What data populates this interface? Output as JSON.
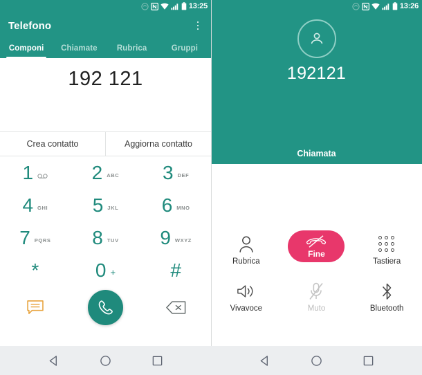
{
  "left": {
    "statusbar": {
      "time": "13:25",
      "icons": [
        "sync-icon",
        "nfc-icon",
        "wifi-icon",
        "signal-icon",
        "battery-icon"
      ]
    },
    "appbar": {
      "title": "Telefono",
      "overflow_icon": "overflow-menu-icon"
    },
    "tabs": [
      {
        "label": "Componi",
        "active": true
      },
      {
        "label": "Chiamate",
        "active": false
      },
      {
        "label": "Rubrica",
        "active": false
      },
      {
        "label": "Gruppi",
        "active": false
      }
    ],
    "dialed_number": "192 121",
    "contact_actions": [
      {
        "label": "Crea contatto"
      },
      {
        "label": "Aggiorna contatto"
      }
    ],
    "keys": [
      {
        "digit": "1",
        "sub": "",
        "icon": "voicemail-icon"
      },
      {
        "digit": "2",
        "sub": "ABC",
        "icon": ""
      },
      {
        "digit": "3",
        "sub": "DEF",
        "icon": ""
      },
      {
        "digit": "4",
        "sub": "GHI",
        "icon": ""
      },
      {
        "digit": "5",
        "sub": "JKL",
        "icon": ""
      },
      {
        "digit": "6",
        "sub": "MNO",
        "icon": ""
      },
      {
        "digit": "7",
        "sub": "PQRS",
        "icon": ""
      },
      {
        "digit": "8",
        "sub": "TUV",
        "icon": ""
      },
      {
        "digit": "9",
        "sub": "WXYZ",
        "icon": ""
      },
      {
        "digit": "*",
        "sub": "",
        "icon": ""
      },
      {
        "digit": "0",
        "sub": "+",
        "icon": ""
      },
      {
        "digit": "#",
        "sub": "",
        "icon": ""
      }
    ],
    "bottom": {
      "sms_icon": "message-icon",
      "call_icon": "call-handset-icon",
      "backspace_icon": "backspace-icon"
    }
  },
  "right": {
    "statusbar": {
      "time": "13:26",
      "icons": [
        "sync-icon",
        "nfc-icon",
        "wifi-icon",
        "signal-icon",
        "battery-icon"
      ]
    },
    "avatar_icon": "person-avatar-icon",
    "call_number": "192121",
    "call_status": "Chiamata",
    "controls": [
      {
        "label": "Rubrica",
        "icon": "contacts-person-icon",
        "disabled": false
      },
      {
        "label": "Fine",
        "icon": "end-call-icon",
        "disabled": false
      },
      {
        "label": "Tastiera",
        "icon": "keypad-dots-icon",
        "disabled": false
      },
      {
        "label": "Vivavoce",
        "icon": "speaker-icon",
        "disabled": false
      },
      {
        "label": "Muto",
        "icon": "mic-muted-icon",
        "disabled": true
      },
      {
        "label": "Bluetooth",
        "icon": "bluetooth-icon",
        "disabled": false
      }
    ]
  },
  "navbar": {
    "buttons": [
      {
        "name": "back-icon"
      },
      {
        "name": "home-icon"
      },
      {
        "name": "recents-icon"
      }
    ]
  },
  "colors": {
    "teal": "#229485",
    "teal_dark": "#1f8a7c",
    "end_red": "#e8376b",
    "sms_amber": "#e8a33d",
    "navbar_bg": "#eceef0"
  }
}
